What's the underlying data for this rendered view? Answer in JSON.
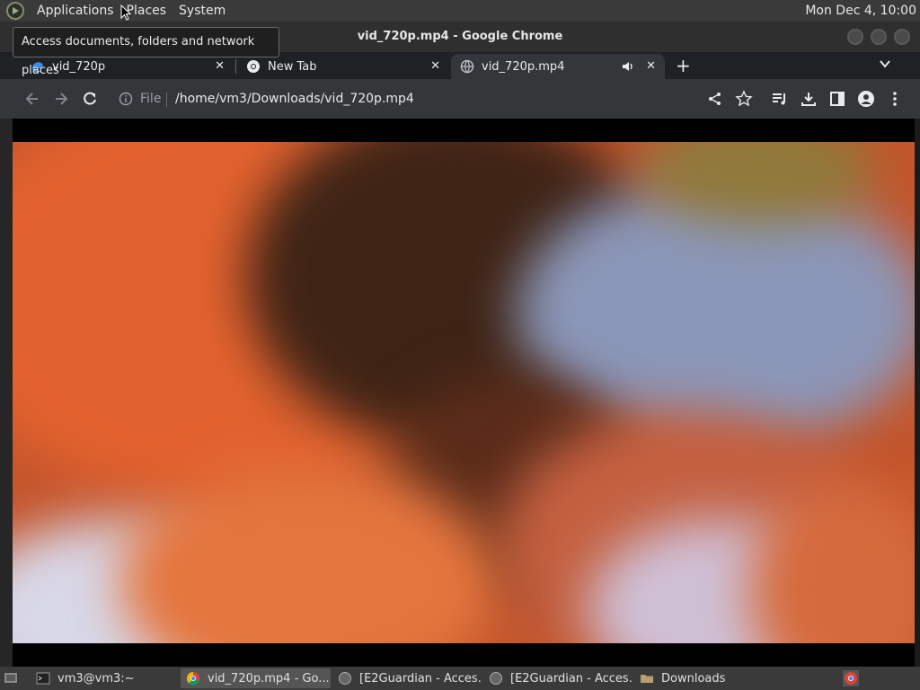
{
  "top_panel": {
    "menus": [
      "Applications",
      "Places",
      "System"
    ],
    "clock": "Mon Dec  4, 10:00"
  },
  "tooltip": {
    "text": "Access documents, folders and network places"
  },
  "window": {
    "title": "vid_720p.mp4 - Google Chrome"
  },
  "tabs": [
    {
      "label": "vid_720p",
      "icon": "edge-like-icon"
    },
    {
      "label": "New Tab",
      "icon": "chrome-icon"
    },
    {
      "label": "vid_720p.mp4",
      "icon": "globe-icon",
      "audio": true
    }
  ],
  "toolbar": {
    "scheme": "File",
    "url": "/home/vm3/Downloads/vid_720p.mp4"
  },
  "taskbar": {
    "items": [
      {
        "label": "vm3@vm3:~",
        "icon": "terminal-icon"
      },
      {
        "label": "vid_720p.mp4 - Go...",
        "icon": "chrome-icon"
      },
      {
        "label": "[E2Guardian - Acces...",
        "icon": "globe-icon"
      },
      {
        "label": "[E2Guardian - Acces...",
        "icon": "globe-icon"
      },
      {
        "label": "Downloads",
        "icon": "folder-icon"
      }
    ]
  },
  "colors": {
    "panel": "#3a3a3a",
    "chrome_dark": "#202124",
    "toolbar": "#35363a"
  }
}
